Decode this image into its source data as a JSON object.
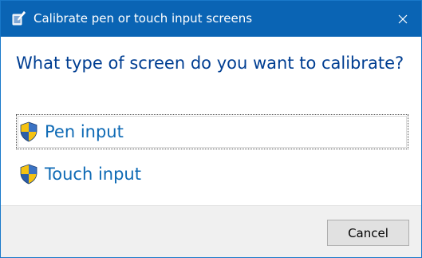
{
  "window": {
    "title": "Calibrate pen or touch input screens",
    "app_icon": "tablet-pen-icon",
    "close_icon": "close-icon"
  },
  "main": {
    "heading": "What type of screen do you want to calibrate?",
    "options": [
      {
        "label": "Pen input",
        "icon": "uac-shield-icon",
        "focused": true
      },
      {
        "label": "Touch input",
        "icon": "uac-shield-icon",
        "focused": false
      }
    ]
  },
  "footer": {
    "cancel_label": "Cancel"
  },
  "colors": {
    "titlebar": "#0a64b4",
    "heading": "#003e92",
    "link": "#0e6ab5",
    "footer_bg": "#f0f0f0"
  }
}
